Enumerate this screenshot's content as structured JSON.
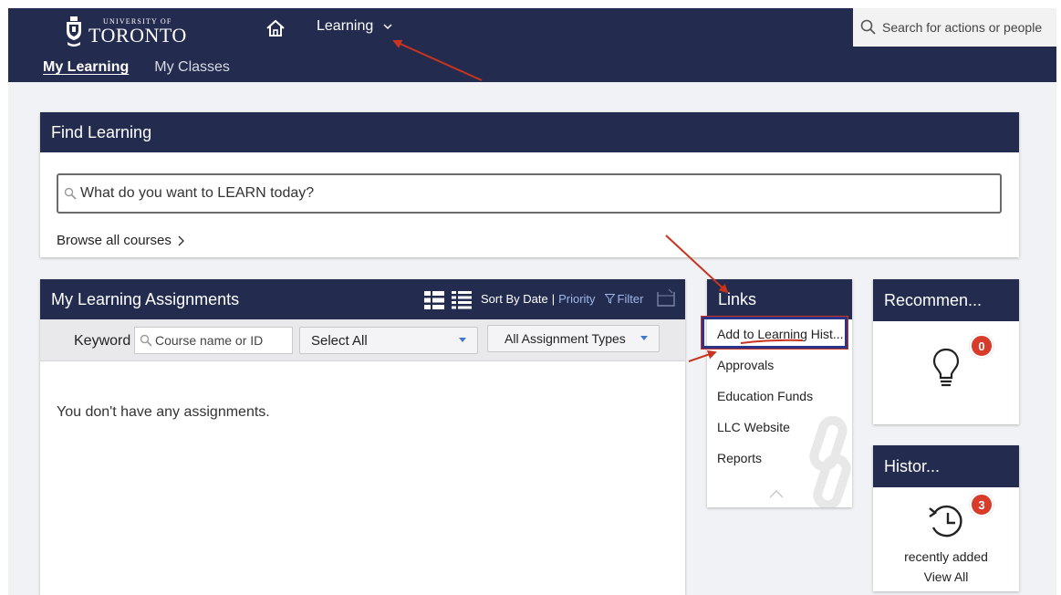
{
  "header": {
    "logo_small": "UNIVERSITY OF",
    "logo_big": "TORONTO",
    "nav_learning": "Learning",
    "search_placeholder": "Search for actions or people"
  },
  "subnav": {
    "my_learning": "My Learning",
    "my_classes": "My Classes"
  },
  "find_learning": {
    "title": "Find Learning",
    "placeholder": "What do you want to LEARN today?",
    "browse": "Browse all courses"
  },
  "assignments": {
    "title": "My Learning Assignments",
    "sort_by_date": "Sort By Date",
    "separator": "|",
    "priority": "Priority",
    "filter": "Filter",
    "keyword_label": "Keyword",
    "keyword_placeholder": "Course name or ID",
    "select_all": "Select All",
    "assignment_types": "All Assignment Types",
    "empty_message": "You don't have any assignments."
  },
  "links": {
    "title": "Links",
    "items": [
      "Add to Learning Hist...",
      "Approvals",
      "Education Funds",
      "LLC Website",
      "Reports"
    ]
  },
  "recommended": {
    "title": "Recommen...",
    "count": "0"
  },
  "history": {
    "title": "Histor...",
    "count": "3",
    "recent": "recently added",
    "view_all": "View All"
  },
  "colors": {
    "header_navy": "#232c4f",
    "badge_red": "#d93b2b",
    "annotation_red": "#c8341f",
    "highlight_blue": "#2a358a",
    "link_blue": "#9fb6e6"
  }
}
